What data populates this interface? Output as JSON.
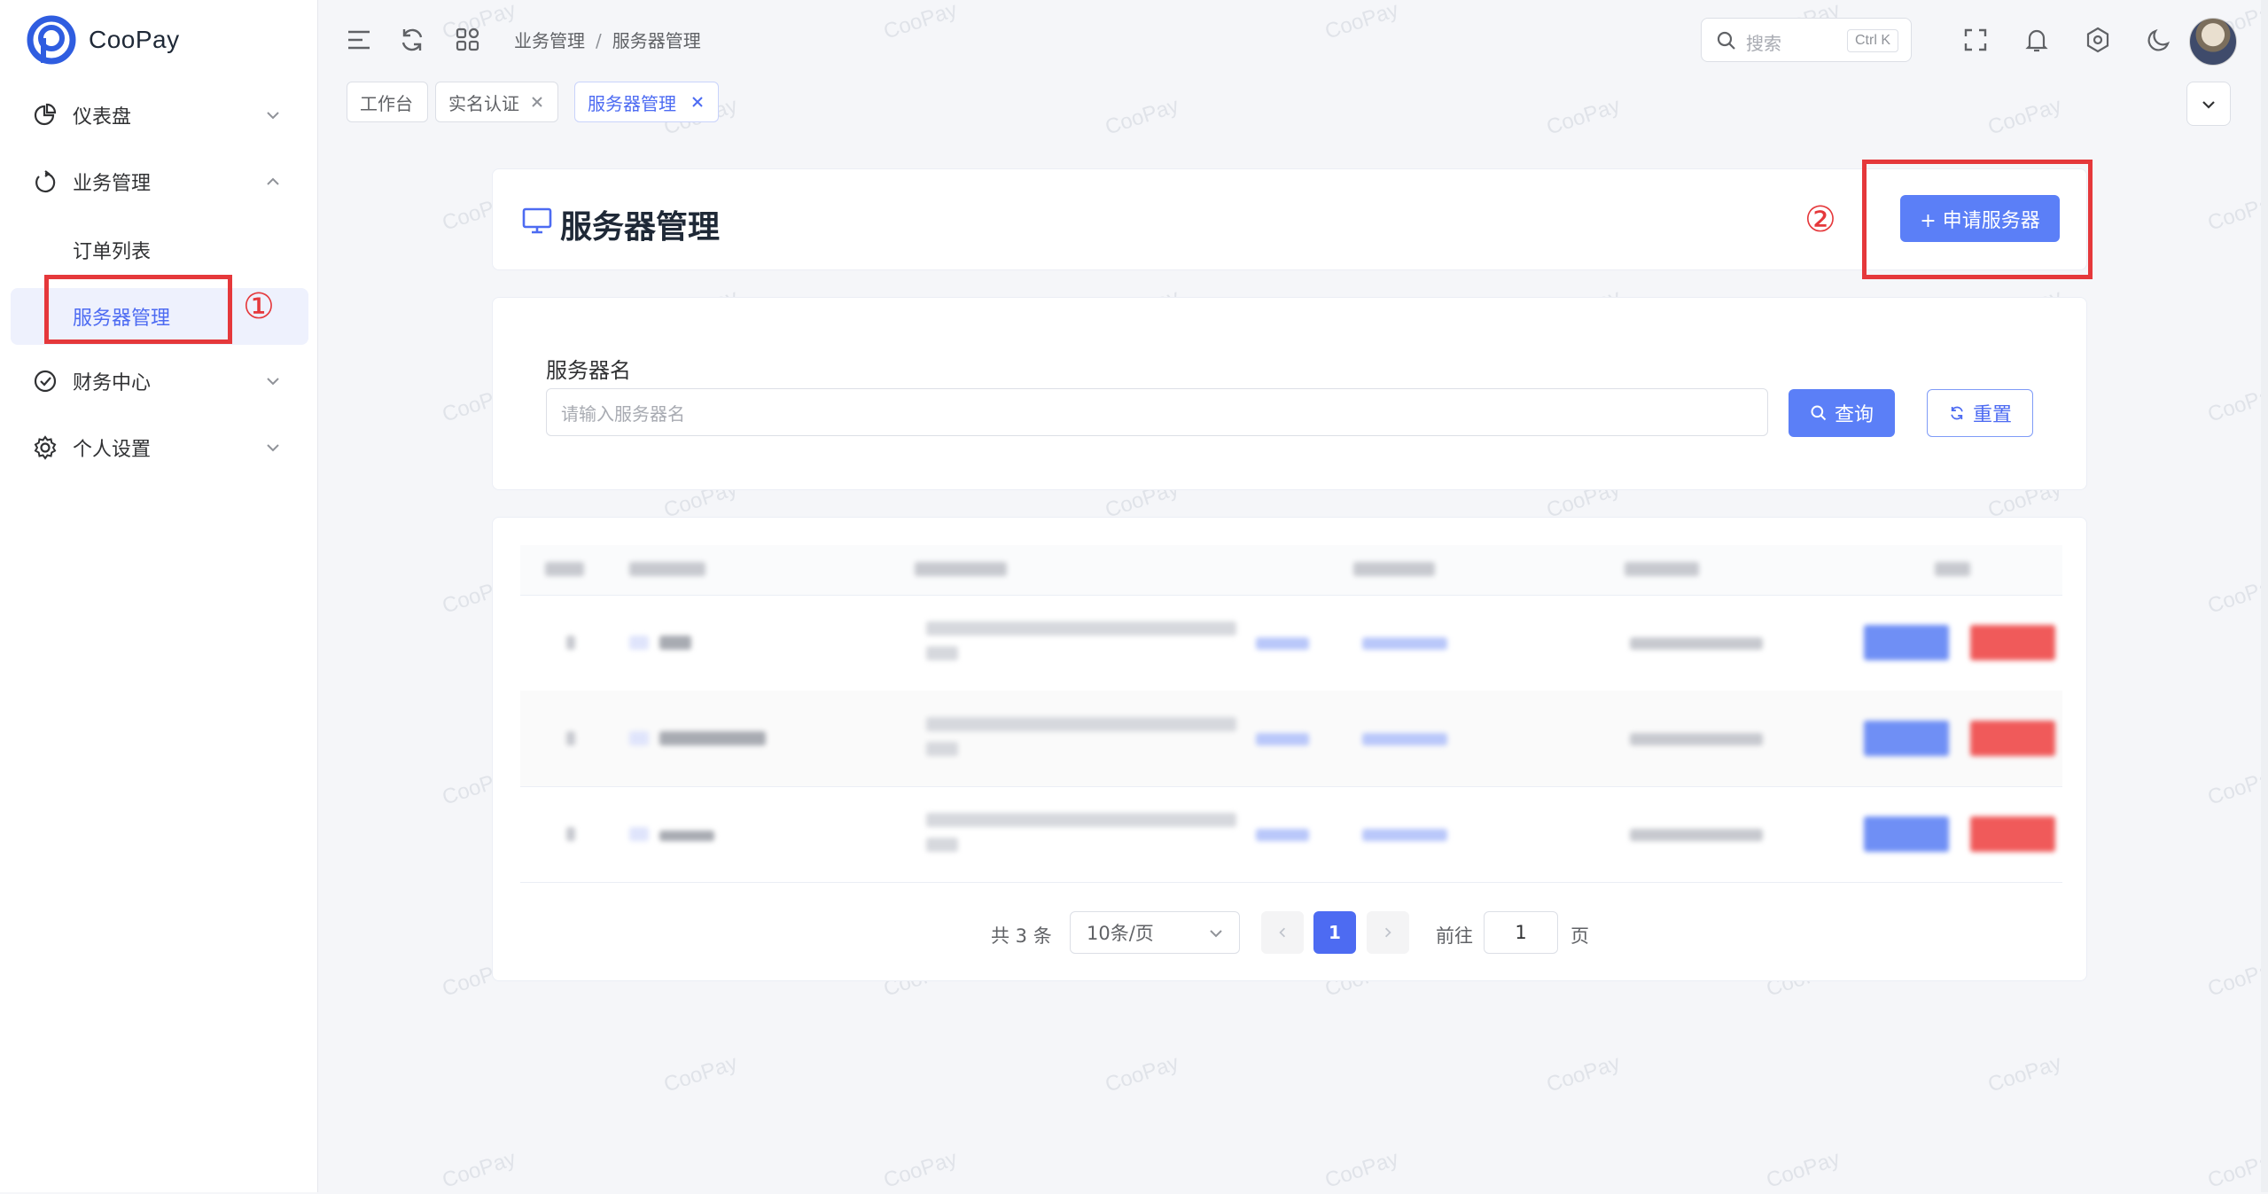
{
  "app": {
    "name": "CooPay",
    "watermark": "CooPay"
  },
  "sidebar": {
    "items": [
      {
        "label": "仪表盘",
        "icon": "pie-chart-icon",
        "expanded": false
      },
      {
        "label": "业务管理",
        "icon": "refresh-circle-icon",
        "expanded": true,
        "children": [
          {
            "label": "订单列表"
          },
          {
            "label": "服务器管理",
            "active": true
          }
        ]
      },
      {
        "label": "财务中心",
        "icon": "check-circle-icon",
        "expanded": false
      },
      {
        "label": "个人设置",
        "icon": "gear-icon",
        "expanded": false
      }
    ]
  },
  "header": {
    "breadcrumb": [
      "业务管理",
      "服务器管理"
    ],
    "breadcrumb_separator": "/",
    "search": {
      "placeholder": "搜索",
      "shortcut": "Ctrl K"
    }
  },
  "tabs": [
    {
      "label": "工作台",
      "closable": false,
      "active": false
    },
    {
      "label": "实名认证",
      "closable": true,
      "active": false
    },
    {
      "label": "服务器管理",
      "closable": true,
      "active": true
    }
  ],
  "page": {
    "title": "服务器管理",
    "apply_button": "+ 申请服务器",
    "filter": {
      "label": "服务器名",
      "placeholder": "请输入服务器名",
      "query_button": "查询",
      "reset_button": "重置"
    }
  },
  "pagination": {
    "total_text": "共 3 条",
    "page_size": "10条/页",
    "current_page": "1",
    "goto_label": "前往",
    "goto_value": "1",
    "page_unit": "页"
  },
  "annotations": [
    "①",
    "②"
  ],
  "colors": {
    "primary": "#5b7ff7",
    "danger": "#f05a5a",
    "annotation": "#e5383b"
  }
}
